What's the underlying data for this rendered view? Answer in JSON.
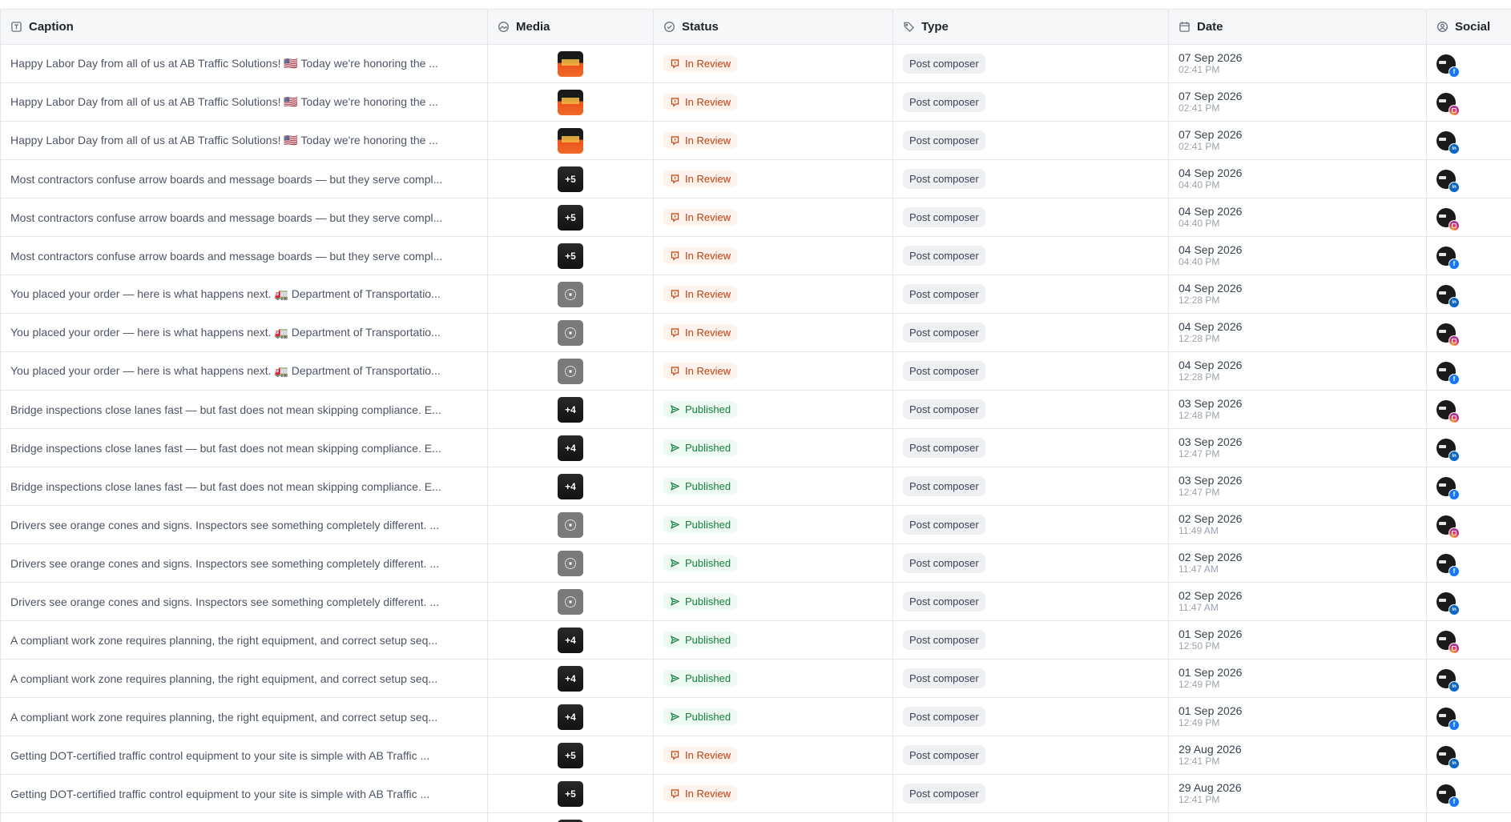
{
  "columns": [
    {
      "label": "Caption",
      "icon": "text-field-icon"
    },
    {
      "label": "Media",
      "icon": "image-icon"
    },
    {
      "label": "Status",
      "icon": "check-circle-icon"
    },
    {
      "label": "Type",
      "icon": "tag-icon"
    },
    {
      "label": "Date",
      "icon": "calendar-icon"
    },
    {
      "label": "Social",
      "icon": "user-circle-icon"
    }
  ],
  "colors": {
    "review": "#c2410c",
    "published": "#15803d",
    "facebook": "#1877f2",
    "linkedin": "#0a66c2"
  },
  "rows": [
    {
      "caption": "Happy Labor Day from all of us at AB Traffic Solutions! 🇺🇸 Today we're honoring the ...",
      "media": "labor",
      "media_count": "",
      "status": "In Review",
      "type": "Post composer",
      "date": "07 Sep 2026",
      "time": "02:41 PM",
      "network": "facebook"
    },
    {
      "caption": "Happy Labor Day from all of us at AB Traffic Solutions! 🇺🇸 Today we're honoring the ...",
      "media": "labor",
      "media_count": "",
      "status": "In Review",
      "type": "Post composer",
      "date": "07 Sep 2026",
      "time": "02:41 PM",
      "network": "instagram"
    },
    {
      "caption": "Happy Labor Day from all of us at AB Traffic Solutions! 🇺🇸 Today we're honoring the ...",
      "media": "labor",
      "media_count": "",
      "status": "In Review",
      "type": "Post composer",
      "date": "07 Sep 2026",
      "time": "02:41 PM",
      "network": "linkedin"
    },
    {
      "caption": "Most contractors confuse arrow boards and message boards — but they serve compl...",
      "media": "dark",
      "media_count": "+5",
      "status": "In Review",
      "type": "Post composer",
      "date": "04 Sep 2026",
      "time": "04:40 PM",
      "network": "linkedin"
    },
    {
      "caption": "Most contractors confuse arrow boards and message boards — but they serve compl...",
      "media": "dark",
      "media_count": "+5",
      "status": "In Review",
      "type": "Post composer",
      "date": "04 Sep 2026",
      "time": "04:40 PM",
      "network": "instagram"
    },
    {
      "caption": "Most contractors confuse arrow boards and message boards — but they serve compl...",
      "media": "dark",
      "media_count": "+5",
      "status": "In Review",
      "type": "Post composer",
      "date": "04 Sep 2026",
      "time": "04:40 PM",
      "network": "facebook"
    },
    {
      "caption": "You placed your order — here is what happens next. 🚛 Department of Transportatio...",
      "media": "video",
      "media_count": "",
      "status": "In Review",
      "type": "Post composer",
      "date": "04 Sep 2026",
      "time": "12:28 PM",
      "network": "linkedin"
    },
    {
      "caption": "You placed your order — here is what happens next. 🚛 Department of Transportatio...",
      "media": "video",
      "media_count": "",
      "status": "In Review",
      "type": "Post composer",
      "date": "04 Sep 2026",
      "time": "12:28 PM",
      "network": "instagram"
    },
    {
      "caption": "You placed your order — here is what happens next. 🚛 Department of Transportatio...",
      "media": "video",
      "media_count": "",
      "status": "In Review",
      "type": "Post composer",
      "date": "04 Sep 2026",
      "time": "12:28 PM",
      "network": "facebook"
    },
    {
      "caption": "Bridge inspections close lanes fast — but fast does not mean skipping compliance. E...",
      "media": "dark",
      "media_count": "+4",
      "status": "Published",
      "type": "Post composer",
      "date": "03 Sep 2026",
      "time": "12:48 PM",
      "network": "instagram"
    },
    {
      "caption": "Bridge inspections close lanes fast — but fast does not mean skipping compliance. E...",
      "media": "dark",
      "media_count": "+4",
      "status": "Published",
      "type": "Post composer",
      "date": "03 Sep 2026",
      "time": "12:47 PM",
      "network": "linkedin"
    },
    {
      "caption": "Bridge inspections close lanes fast — but fast does not mean skipping compliance. E...",
      "media": "dark",
      "media_count": "+4",
      "status": "Published",
      "type": "Post composer",
      "date": "03 Sep 2026",
      "time": "12:47 PM",
      "network": "facebook"
    },
    {
      "caption": "Drivers see orange cones and signs. Inspectors see something completely different. ...",
      "media": "video",
      "media_count": "",
      "status": "Published",
      "type": "Post composer",
      "date": "02 Sep 2026",
      "time": "11:49 AM",
      "network": "instagram"
    },
    {
      "caption": "Drivers see orange cones and signs. Inspectors see something completely different. ...",
      "media": "video",
      "media_count": "",
      "status": "Published",
      "type": "Post composer",
      "date": "02 Sep 2026",
      "time": "11:47 AM",
      "network": "facebook"
    },
    {
      "caption": "Drivers see orange cones and signs. Inspectors see something completely different. ...",
      "media": "video",
      "media_count": "",
      "status": "Published",
      "type": "Post composer",
      "date": "02 Sep 2026",
      "time": "11:47 AM",
      "network": "linkedin"
    },
    {
      "caption": "A compliant work zone requires planning, the right equipment, and correct setup seq...",
      "media": "dark",
      "media_count": "+4",
      "status": "Published",
      "type": "Post composer",
      "date": "01 Sep 2026",
      "time": "12:50 PM",
      "network": "instagram"
    },
    {
      "caption": "A compliant work zone requires planning, the right equipment, and correct setup seq...",
      "media": "dark",
      "media_count": "+4",
      "status": "Published",
      "type": "Post composer",
      "date": "01 Sep 2026",
      "time": "12:49 PM",
      "network": "linkedin"
    },
    {
      "caption": "A compliant work zone requires planning, the right equipment, and correct setup seq...",
      "media": "dark",
      "media_count": "+4",
      "status": "Published",
      "type": "Post composer",
      "date": "01 Sep 2026",
      "time": "12:49 PM",
      "network": "facebook"
    },
    {
      "caption": "Getting DOT-certified traffic control equipment to your site is simple with AB Traffic ...",
      "media": "dark",
      "media_count": "+5",
      "status": "In Review",
      "type": "Post composer",
      "date": "29 Aug 2026",
      "time": "12:41 PM",
      "network": "linkedin"
    },
    {
      "caption": "Getting DOT-certified traffic control equipment to your site is simple with AB Traffic ...",
      "media": "dark",
      "media_count": "+5",
      "status": "In Review",
      "type": "Post composer",
      "date": "29 Aug 2026",
      "time": "12:41 PM",
      "network": "facebook"
    },
    {
      "caption": "",
      "media": "dark",
      "media_count": "",
      "status": "",
      "type": "",
      "date": "",
      "time": "",
      "network": ""
    }
  ]
}
